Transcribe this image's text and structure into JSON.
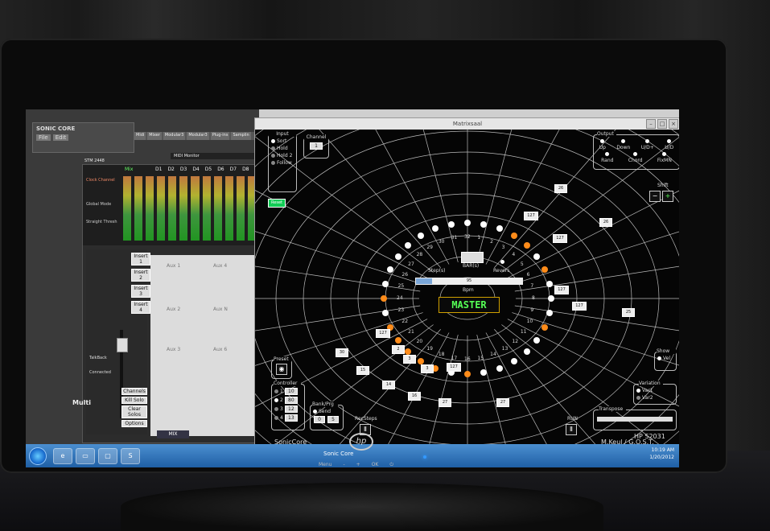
{
  "left_app": {
    "brand": "SONIC CORE",
    "menu": [
      "File",
      "Edit"
    ],
    "tabs": [
      "Midi",
      "Mixer",
      "Modular3",
      "Modular3",
      "Plug-ins",
      "Samplin"
    ],
    "mixer_title": "STM 2448",
    "midi_monitor": "MIDI Monitor",
    "channels": [
      "D1",
      "D2",
      "D3",
      "D4",
      "D5",
      "D6",
      "D7",
      "D8"
    ],
    "mix_label": "Mix",
    "clock_channel": "Clock Channel",
    "global_mode": "Global Mode",
    "straight_thresh": "Straight Thresh",
    "inserts": [
      "Insert 1",
      "Insert 2",
      "Insert 3",
      "Insert 4"
    ],
    "aux": [
      "Aux 1",
      "Aux 4",
      "Aux 2",
      "Aux N",
      "Aux 3",
      "Aux 6"
    ],
    "bottom_buttons": [
      "Channels",
      "Kill Solo",
      "Clear Solos",
      "Options"
    ],
    "mix_button": "MIX",
    "multi": "Multi",
    "talkback": "TalkBack",
    "connected": "Connected"
  },
  "taskbar": {
    "time": "10:19 AM",
    "date": "1/20/2012",
    "active_app": "Sonic Core"
  },
  "window": {
    "title": "Matrixsaal",
    "input": {
      "label": "Input",
      "options": [
        "Sort",
        "Hold",
        "Hold 2",
        "Follow"
      ],
      "selected": "Sort"
    },
    "channel": {
      "label": "Channel",
      "value": "1"
    },
    "output": {
      "label": "Output",
      "options": [
        "Up",
        "Down",
        "U/D+",
        "U/D",
        "Rand",
        "Chord",
        "FixMN"
      ]
    },
    "shift_label": "Shift",
    "reset_label": "Reset",
    "center": {
      "bars_label": "BAR(s)",
      "steps_label": "Step(s)",
      "revers_label": "Revers",
      "bpm_value": "95",
      "bpm_label": "Bpm",
      "bpm_fill": 0.15,
      "master_label": "MASTER"
    },
    "step_numbers": [
      "32",
      "1",
      "2",
      "3",
      "4",
      "5",
      "6",
      "7",
      "8",
      "9",
      "10",
      "11",
      "12",
      "13",
      "14",
      "15",
      "16",
      "17",
      "18",
      "19",
      "20",
      "21",
      "22",
      "23",
      "24",
      "25",
      "26",
      "27",
      "28",
      "29",
      "30",
      "31"
    ],
    "step_active": [
      false,
      false,
      false,
      true,
      true,
      false,
      true,
      false,
      false,
      false,
      true,
      false,
      false,
      false,
      false,
      false,
      true,
      false,
      true,
      true,
      true,
      true,
      true,
      false,
      true,
      false,
      false,
      false,
      false,
      false,
      false,
      false
    ],
    "velocity_boxes": [
      "127",
      "127",
      "127",
      "127",
      "127",
      "127",
      "127",
      "127"
    ],
    "value_boxes": [
      "26",
      "26",
      "25",
      "30",
      "15",
      "14",
      "16",
      "27",
      "27",
      "2",
      "3",
      "3"
    ],
    "preset_label": "Preset",
    "controller": {
      "label": "Controller",
      "rows": [
        {
          "n": "1",
          "v": "10"
        },
        {
          "n": "2",
          "v": "80"
        },
        {
          "n": "3",
          "v": "12"
        },
        {
          "n": "4",
          "v": "13"
        }
      ]
    },
    "bankprg": {
      "label": "Bank/Prg",
      "send": "Send",
      "bank": "0",
      "prg": "5"
    },
    "recsteps": "RecSteps",
    "run": "RUN",
    "show": {
      "label": "Show",
      "vel": "Vel"
    },
    "variation": {
      "label": "Variation",
      "var1": "Var1",
      "var2": "Var2"
    },
    "transpose": "Transpose",
    "footer_left": "SonicCore",
    "footer_right": "M.Keul / G.O.S.T."
  },
  "monitor": {
    "brand": "hp",
    "model": "HP S2031",
    "menu": "Menu",
    "minus": "-",
    "plus": "+",
    "ok": "OK",
    "power": "⏻"
  },
  "colors": {
    "active_step": "#ff8c1a",
    "inactive_step": "#ffffff",
    "master_text": "#5cff5c",
    "taskbar": "#2b6cb5"
  }
}
